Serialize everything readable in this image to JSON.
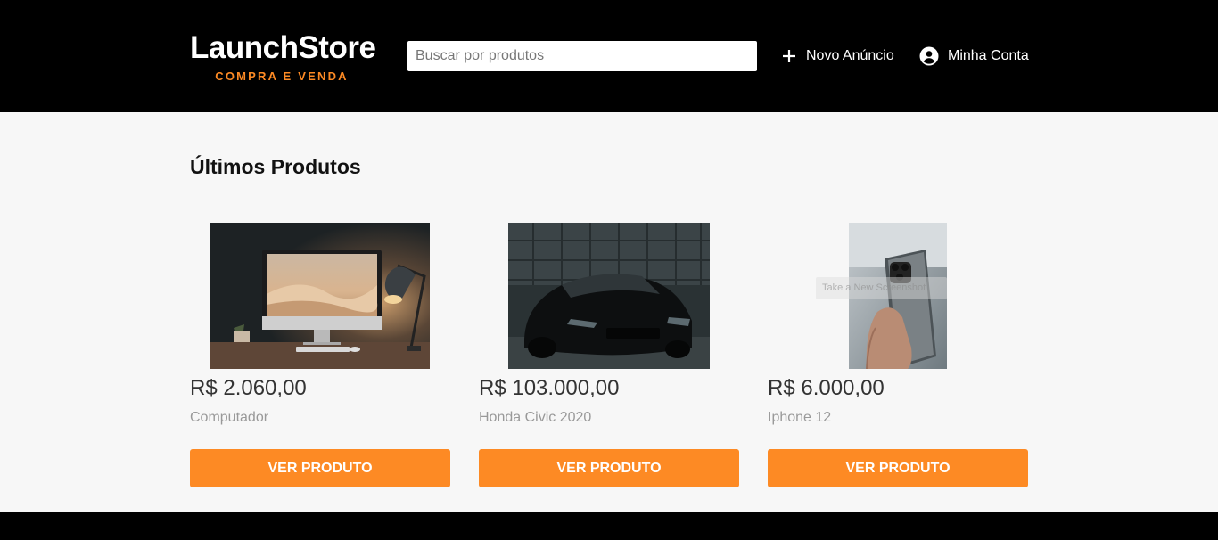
{
  "header": {
    "logo_title": "LaunchStore",
    "logo_subtitle": "COMPRA E VENDA",
    "search_placeholder": "Buscar por produtos",
    "new_ad_label": "Novo Anúncio",
    "account_label": "Minha Conta",
    "icons": {
      "new_ad": "plus-icon",
      "account": "user-circle-icon"
    }
  },
  "main": {
    "title": "Últimos Produtos",
    "products": [
      {
        "price": "R$ 2.060,00",
        "name": "Computador",
        "button": "VER PRODUTO",
        "image": "desk-computer-photo"
      },
      {
        "price": "R$ 103.000,00",
        "name": "Honda Civic 2020",
        "button": "VER PRODUTO",
        "image": "black-car-photo"
      },
      {
        "price": "R$ 6.000,00",
        "name": "Iphone 12",
        "button": "VER PRODUTO",
        "image": "hand-phone-photo"
      }
    ]
  },
  "overlay": {
    "tooltip_text": "Take a New Screenshot"
  },
  "colors": {
    "accent": "#fd8a24",
    "header_bg": "#000000",
    "page_bg": "#f7f7f7"
  }
}
